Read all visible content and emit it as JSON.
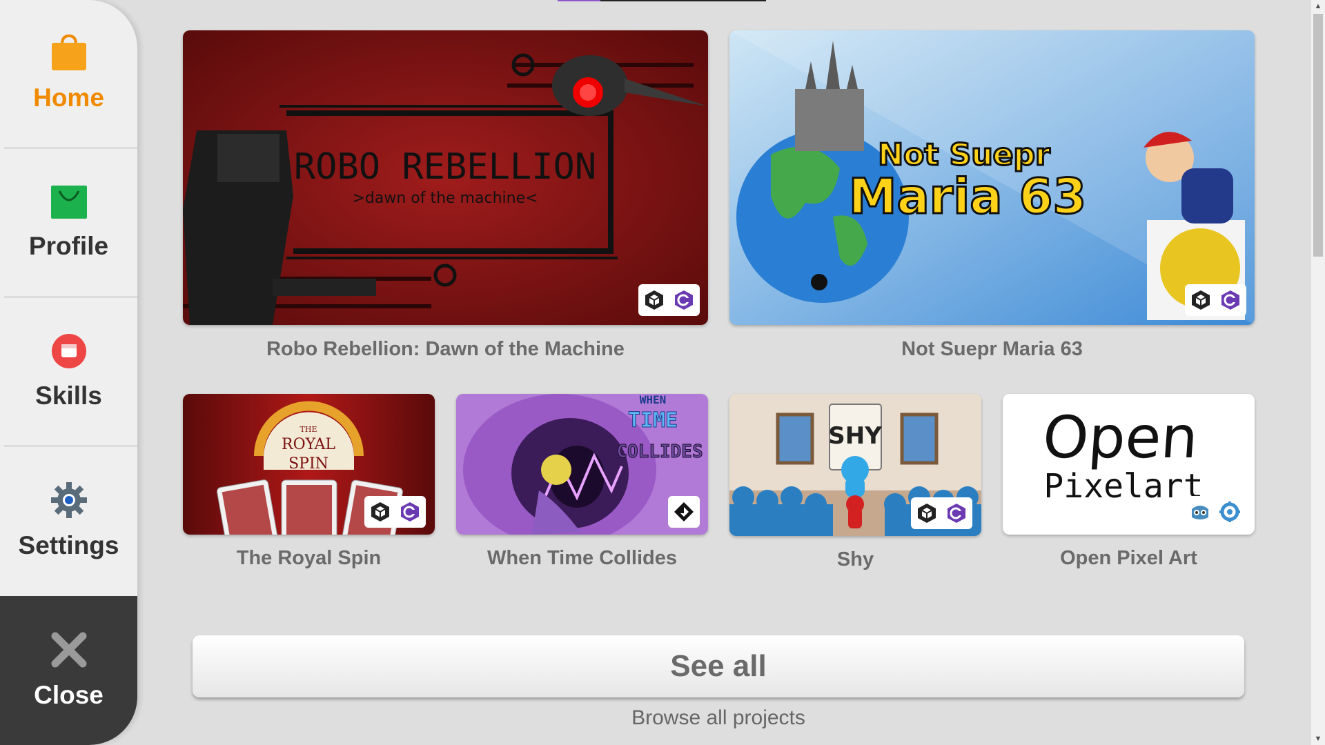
{
  "sidebar": {
    "items": [
      {
        "label": "Home",
        "icon": "shopping-bag-icon"
      },
      {
        "label": "Profile",
        "icon": "profile-bag-icon"
      },
      {
        "label": "Skills",
        "icon": "skills-icon"
      },
      {
        "label": "Settings",
        "icon": "gear-icon"
      },
      {
        "label": "Close",
        "icon": "close-icon"
      }
    ],
    "active_color": "#f08a00"
  },
  "featured": [
    {
      "title": "Robo Rebellion: Dawn of the Machine",
      "art_title": "ROBO REBELLION",
      "art_subtitle": ">dawn of the machine<",
      "badges": [
        "unity-icon",
        "csharp-icon"
      ]
    },
    {
      "title": "Not Suepr Maria 63",
      "art_line1": "Not Suepr",
      "art_line2": "Maria 63",
      "badges": [
        "unity-icon",
        "csharp-icon"
      ]
    }
  ],
  "projects": [
    {
      "title": "The Royal Spin",
      "art_line1": "THE",
      "art_line2": "ROYAL",
      "art_line3": "SPIN",
      "badges": [
        "unity-icon",
        "csharp-icon"
      ]
    },
    {
      "title": "When Time Collides",
      "art_line1": "WHEN",
      "art_line2": "TIME",
      "art_line3": "COLLIDES",
      "badges": [
        "gamemaker-icon"
      ]
    },
    {
      "title": "Shy",
      "art_line1": "SHY",
      "badges": [
        "unity-icon",
        "csharp-icon"
      ]
    },
    {
      "title": "Open Pixel Art",
      "art_line1": "Open",
      "art_line2": "Pixelart",
      "badges": [
        "godot-icon",
        "gear-icon"
      ]
    }
  ],
  "see_all": {
    "label": "See all",
    "subtitle": "Browse all projects"
  }
}
